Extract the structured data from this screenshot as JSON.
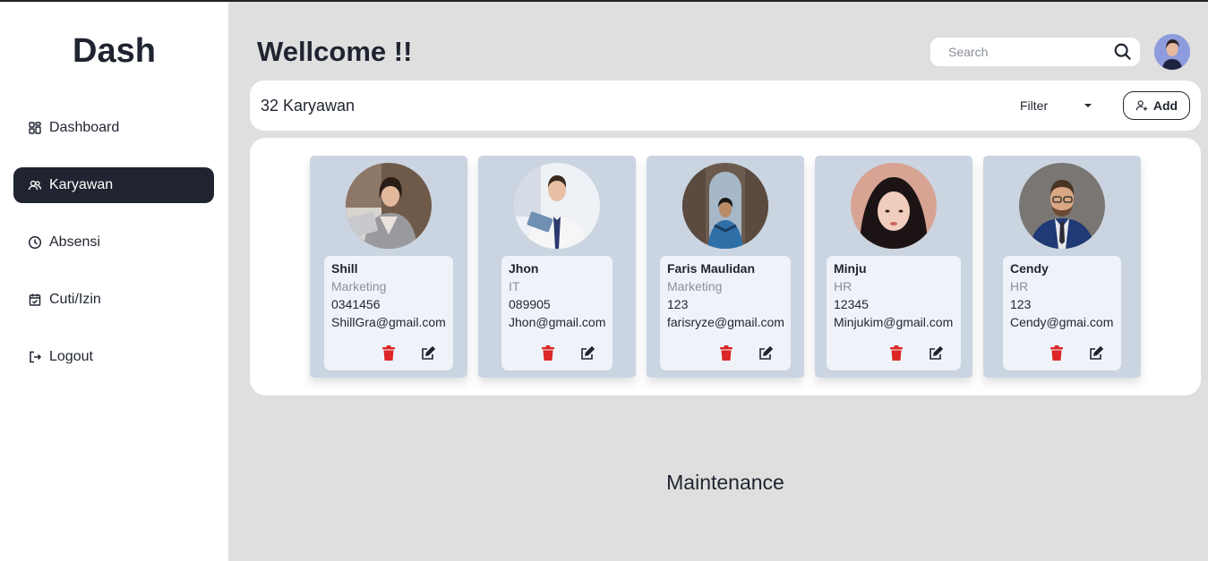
{
  "sidebar": {
    "brand": "Dash",
    "items": [
      {
        "label": "Dashboard",
        "icon": "grid-icon"
      },
      {
        "label": "Karyawan",
        "icon": "users-icon",
        "active": true
      },
      {
        "label": "Absensi",
        "icon": "clock-icon"
      },
      {
        "label": "Cuti/Izin",
        "icon": "calendar-check-icon"
      },
      {
        "label": "Logout",
        "icon": "logout-icon"
      }
    ]
  },
  "header": {
    "title": "Wellcome !!",
    "search_placeholder": "Search"
  },
  "toolbar": {
    "count_label": "32 Karyawan",
    "filter_label": "Filter",
    "add_label": "Add"
  },
  "employees": [
    {
      "name": "Shill",
      "dept": "Marketing",
      "phone": "0341456",
      "email": "ShillGra@gmail.com"
    },
    {
      "name": "Jhon",
      "dept": "IT",
      "phone": "089905",
      "email": "Jhon@gmail.com"
    },
    {
      "name": "Faris Maulidan",
      "dept": "Marketing",
      "phone": "123",
      "email": "farisryze@gmail.com"
    },
    {
      "name": "Minju",
      "dept": "HR",
      "phone": "12345",
      "email": "Minjukim@gmail.com"
    },
    {
      "name": "Cendy",
      "dept": "HR",
      "phone": "123",
      "email": "Cendy@gmai.com"
    }
  ],
  "footer": {
    "maintenance": "Maintenance"
  },
  "colors": {
    "dark": "#1f2430",
    "card_bg": "#cbd5e1",
    "info_bg": "#eff3f9",
    "delete": "#dc2626"
  }
}
